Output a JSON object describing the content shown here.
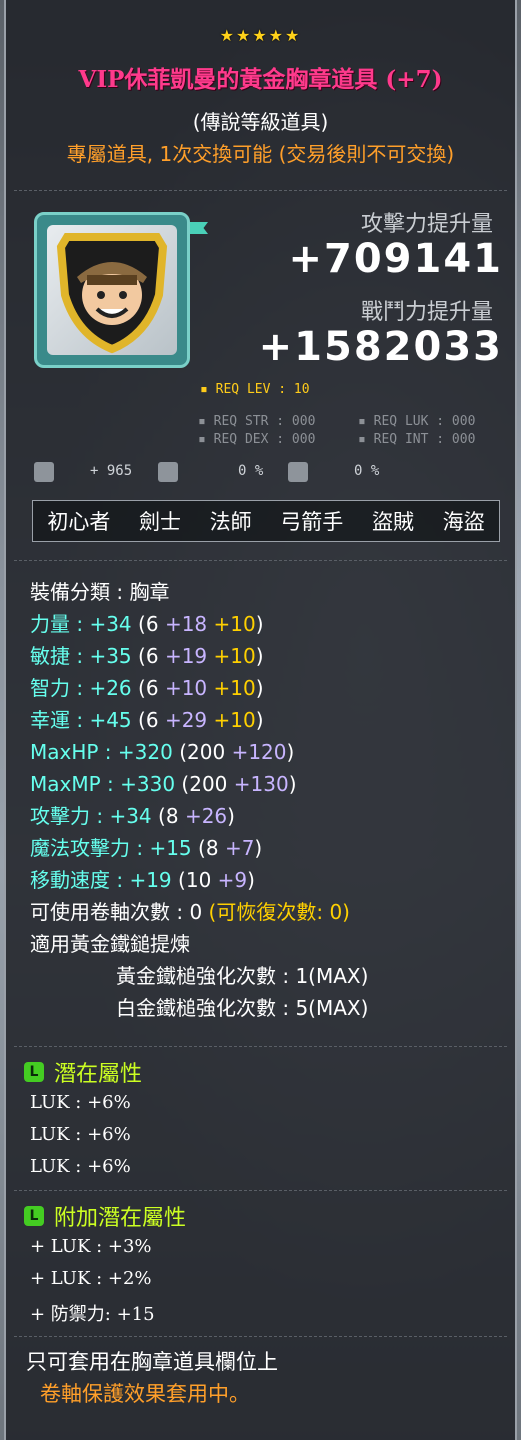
{
  "stars": "★★★★★",
  "item": {
    "name": "VIP休菲凱曼的黃金胸章道具 (+7)",
    "grade": "(傳說等級道具)",
    "trade_note": "專屬道具, 1次交換可能 (交易後則不可交換)"
  },
  "comparison": {
    "atk_label": "攻擊力提升量",
    "atk_value": "+709141",
    "cp_label": "戰鬥力提升量",
    "cp_value": "+1582033"
  },
  "requirements": {
    "lev": "REQ LEV : 10",
    "str": "REQ STR : 000",
    "luk": "REQ LUK : 000",
    "dex": "REQ DEX : 000",
    "int": "REQ INT : 000"
  },
  "mini_stats": {
    "first": "+ 965",
    "second": "0 %",
    "third": "0 %"
  },
  "jobs": [
    "初心者",
    "劍士",
    "法師",
    "弓箭手",
    "盜賊",
    "海盜"
  ],
  "details": {
    "category": "裝備分類 : 胸章",
    "rows": [
      {
        "label": "力量 : ",
        "total": "+34",
        "base": "6",
        "scroll": "+18",
        "star": "+10"
      },
      {
        "label": "敏捷 : ",
        "total": "+35",
        "base": "6",
        "scroll": "+19",
        "star": "+10"
      },
      {
        "label": "智力 : ",
        "total": "+26",
        "base": "6",
        "scroll": "+10",
        "star": "+10"
      },
      {
        "label": "幸運 : ",
        "total": "+45",
        "base": "6",
        "scroll": "+29",
        "star": "+10"
      },
      {
        "label": "MaxHP : ",
        "total": "+320",
        "base": "200",
        "scroll": "+120",
        "star": ""
      },
      {
        "label": "MaxMP : ",
        "total": "+330",
        "base": "200",
        "scroll": "+130",
        "star": ""
      },
      {
        "label": "攻擊力 : ",
        "total": "+34",
        "base": "8",
        "scroll": "+26",
        "star": ""
      },
      {
        "label": "魔法攻擊力 : ",
        "total": "+15",
        "base": "8",
        "scroll": "+7",
        "star": ""
      },
      {
        "label": "移動速度 : ",
        "total": "+19",
        "base": "10",
        "scroll": "+9",
        "star": ""
      }
    ],
    "scroll_count": "可使用卷軸次數 : 0",
    "recoverable": "(可恢復次數: 0)",
    "hammer": "適用黃金鐵鎚提煉",
    "gold_hammer": "黃金鐵槌強化次數 : 1(MAX)",
    "platinum_hammer": "白金鐵槌強化次數 : 5(MAX)"
  },
  "potential": {
    "badge": "L",
    "title": "潛在屬性",
    "lines": [
      "LUK : +6%",
      "LUK : +6%",
      "LUK : +6%"
    ]
  },
  "additional_potential": {
    "badge": "L",
    "title": "附加潛在屬性",
    "lines": [
      "+ LUK : +3%",
      "+ LUK : +2%",
      "+ 防禦力: +15"
    ]
  },
  "footer": {
    "slot_note": "只可套用在胸章道具欄位上",
    "protection": "卷軸保護效果套用中。"
  },
  "colors": {
    "title": "#ff3a8c",
    "trade": "#ff9f2a",
    "stat_label": "#66ffee",
    "scroll_bonus": "#c8b5ff",
    "star_bonus": "#ffd000",
    "potential": "#ccff22"
  }
}
